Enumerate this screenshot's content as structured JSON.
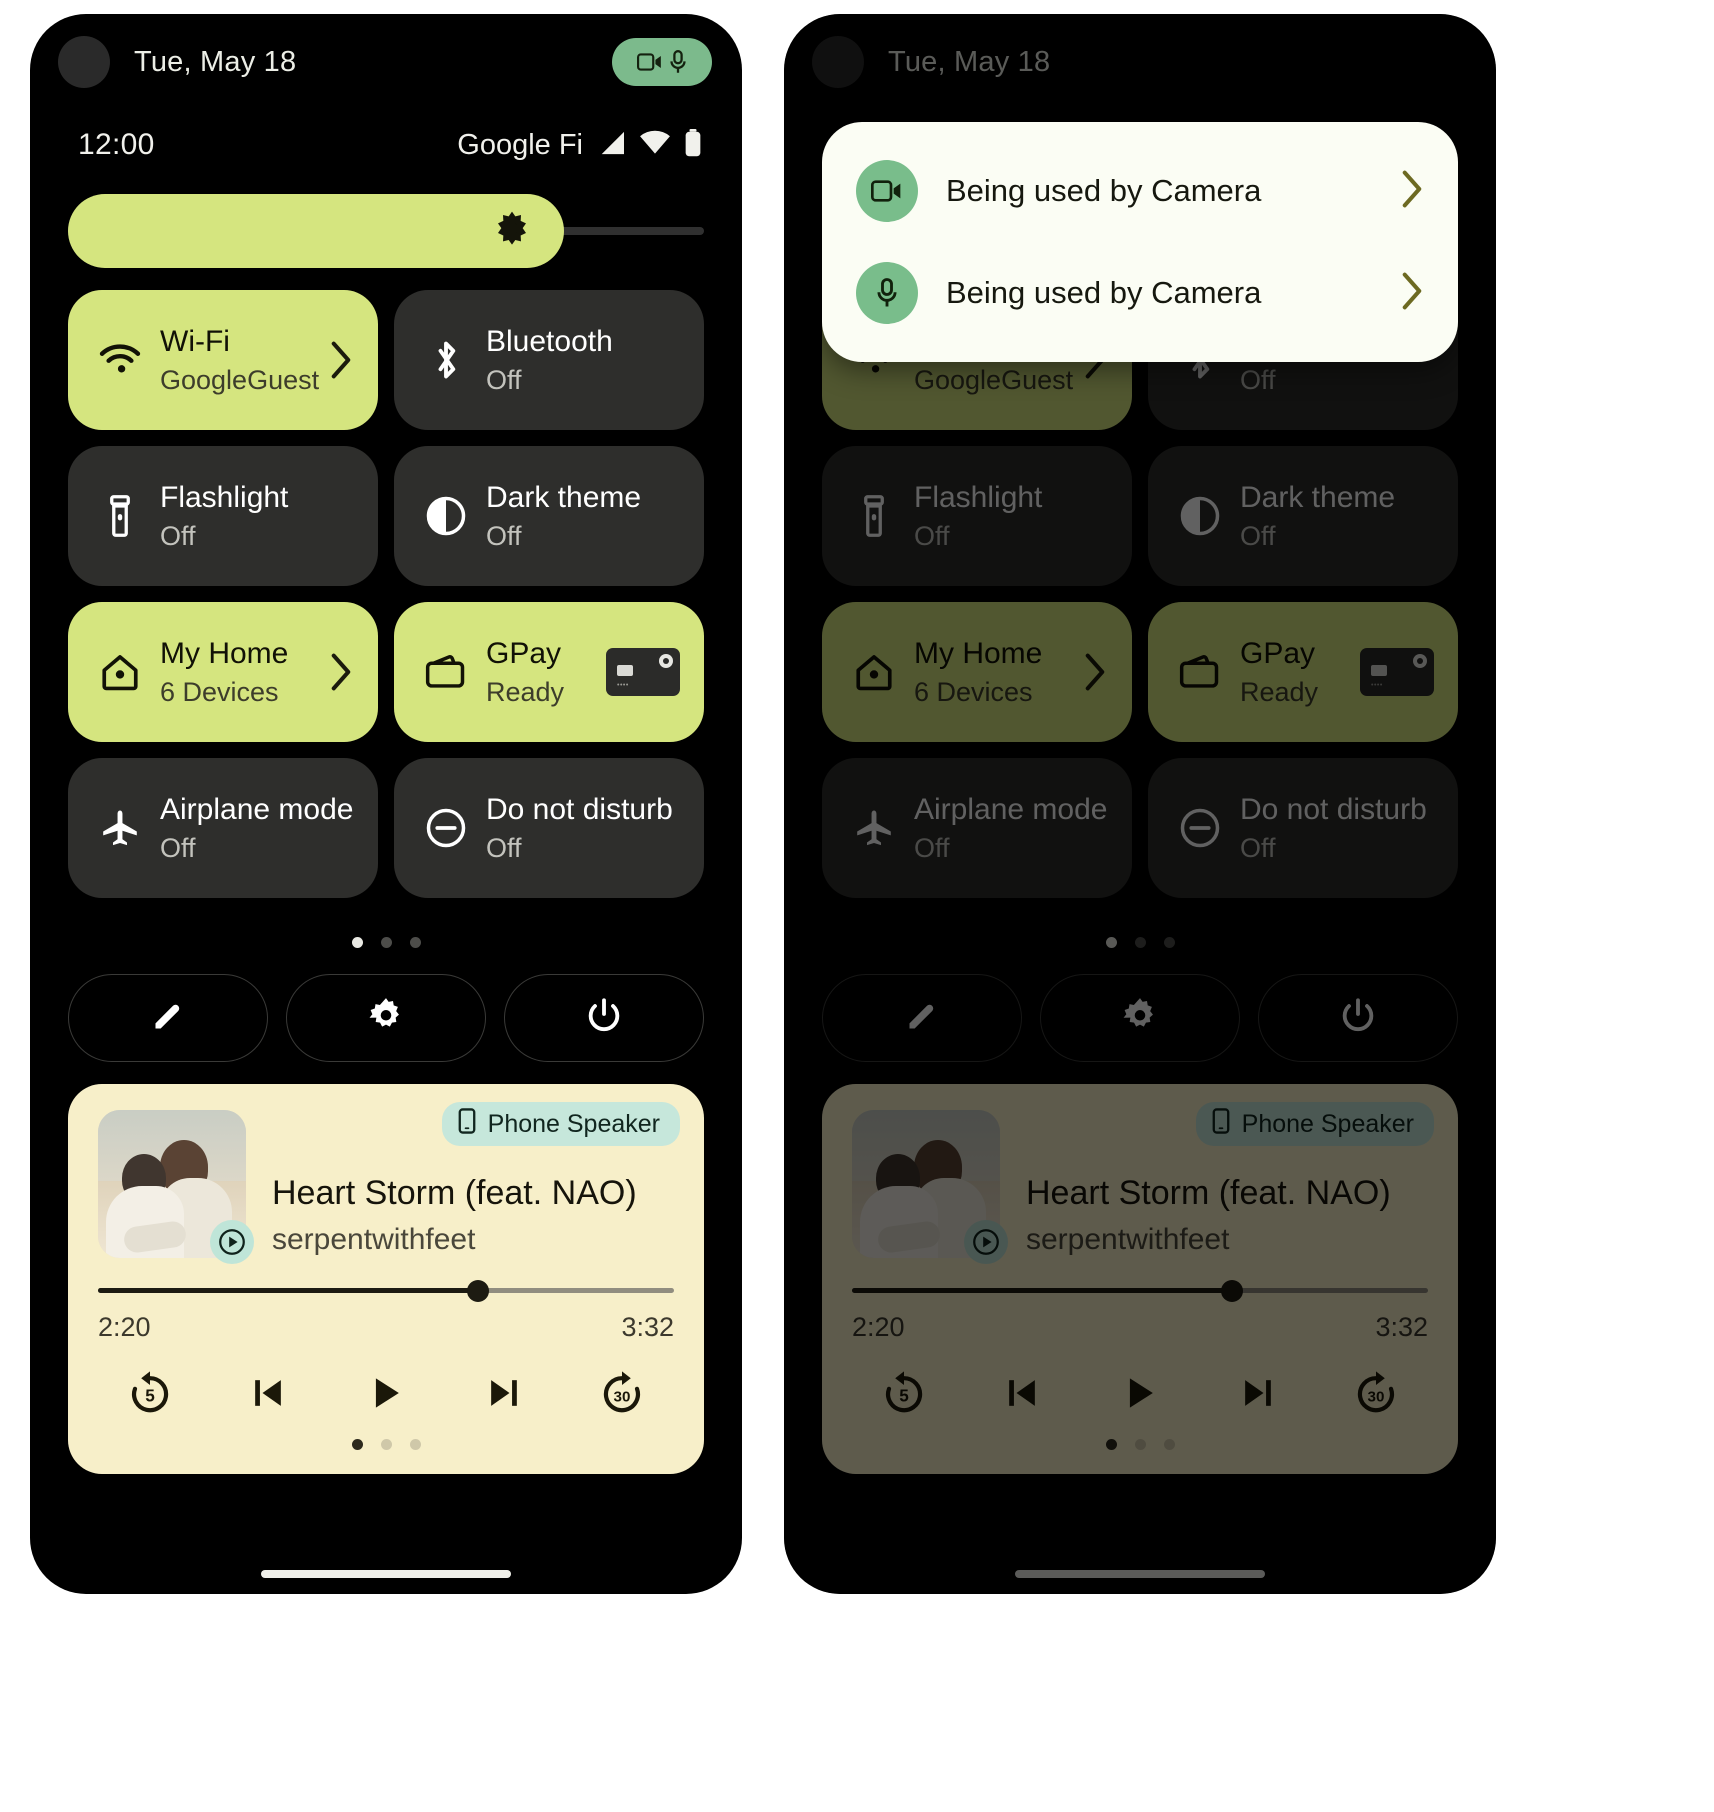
{
  "theme": {
    "accent_green": "#d5e57f",
    "tile_off_bg": "#2e2e2c",
    "media_bg": "#f7efc9",
    "privacy_green": "#79bd8b",
    "device_chip_bg": "#c6e7db",
    "dialog_bg": "#fbfdf4"
  },
  "status": {
    "date": "Tue, May 18",
    "time": "12:00",
    "carrier": "Google Fi",
    "privacy_chip_icons": [
      "camera-icon",
      "microphone-icon"
    ],
    "signal_icon": "cellular-signal-icon",
    "wifi_icon": "wifi-icon",
    "battery_icon": "battery-icon"
  },
  "brightness": {
    "icon": "brightness-icon",
    "value_percent": 78
  },
  "tiles": [
    {
      "name": "wifi",
      "icon": "wifi-icon",
      "title": "Wi-Fi",
      "subtitle": "GoogleGuest",
      "state": "on",
      "trailing": "chevron-right-icon"
    },
    {
      "name": "bluetooth",
      "icon": "bluetooth-icon",
      "title": "Bluetooth",
      "subtitle": "Off",
      "state": "off",
      "trailing": "none"
    },
    {
      "name": "flashlight",
      "icon": "flashlight-icon",
      "title": "Flashlight",
      "subtitle": "Off",
      "state": "off",
      "trailing": "none"
    },
    {
      "name": "dark-theme",
      "icon": "dark-theme-icon",
      "title": "Dark theme",
      "subtitle": "Off",
      "state": "off",
      "trailing": "none"
    },
    {
      "name": "my-home",
      "icon": "home-icon",
      "title": "My Home",
      "subtitle": "6 Devices",
      "state": "on",
      "trailing": "chevron-right-icon"
    },
    {
      "name": "gpay",
      "icon": "wallet-icon",
      "title": "GPay",
      "subtitle": "Ready",
      "state": "on",
      "trailing": "credit-card-thumbnail"
    },
    {
      "name": "airplane-mode",
      "icon": "airplane-icon",
      "title": "Airplane mode",
      "subtitle": "Off",
      "state": "off",
      "trailing": "none"
    },
    {
      "name": "do-not-disturb",
      "icon": "do-not-disturb-icon",
      "title": "Do not disturb",
      "subtitle": "Off",
      "state": "off",
      "trailing": "none"
    }
  ],
  "pager": {
    "total": 3,
    "active_index": 0
  },
  "footer_buttons": [
    {
      "name": "edit-tiles",
      "icon": "pencil-icon"
    },
    {
      "name": "settings",
      "icon": "gear-icon"
    },
    {
      "name": "power",
      "icon": "power-icon"
    }
  ],
  "media": {
    "device_chip": {
      "icon": "phone-icon",
      "label": "Phone Speaker"
    },
    "title": "Heart Storm (feat. NAO)",
    "artist": "serpentwithfeet",
    "album_art_badge": "play-circle-icon",
    "progress_percent": 66,
    "elapsed": "2:20",
    "duration": "3:32",
    "controls": [
      {
        "name": "rewind-5",
        "icon": "replay-5-icon"
      },
      {
        "name": "previous-track",
        "icon": "skip-previous-icon"
      },
      {
        "name": "play",
        "icon": "play-icon"
      },
      {
        "name": "next-track",
        "icon": "skip-next-icon"
      },
      {
        "name": "forward-30",
        "icon": "forward-30-icon"
      }
    ],
    "pager": {
      "total": 3,
      "active_index": 0
    }
  },
  "privacy_dialog": {
    "rows": [
      {
        "icon": "camera-icon",
        "label": "Being used by Camera",
        "trailing": "chevron-right-icon"
      },
      {
        "icon": "microphone-icon",
        "label": "Being used by Camera",
        "trailing": "chevron-right-icon"
      }
    ]
  }
}
